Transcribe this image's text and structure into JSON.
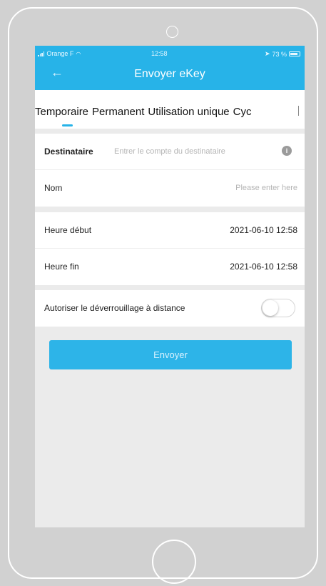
{
  "status_bar": {
    "carrier": "Orange F",
    "time": "12:58",
    "battery": "73 %"
  },
  "header": {
    "back_icon": "back-arrow-icon",
    "title": "Envoyer eKey"
  },
  "tabs": [
    {
      "label": "Temporaire",
      "selected": true
    },
    {
      "label": "Permanent",
      "selected": false
    },
    {
      "label": "Utilisation unique",
      "selected": false
    },
    {
      "label": "Cyc",
      "selected": false
    }
  ],
  "form": {
    "recipient": {
      "label": "Destinataire",
      "placeholder": "Entrer le compte du destinataire",
      "value": "",
      "icon": "info-icon"
    },
    "name": {
      "label": "Nom",
      "placeholder": "Please enter here",
      "value": ""
    },
    "start_time": {
      "label": "Heure début",
      "value": "2021-06-10 12:58"
    },
    "end_time": {
      "label": "Heure fin",
      "value": "2021-06-10 12:58"
    },
    "remote_unlock": {
      "label": "Autoriser le déverrouillage à distance",
      "enabled": false
    }
  },
  "send_button": {
    "label": "Envoyer"
  },
  "colors": {
    "accent": "#27b3e8",
    "background": "#ebebeb",
    "frame": "#d1d1d1"
  }
}
